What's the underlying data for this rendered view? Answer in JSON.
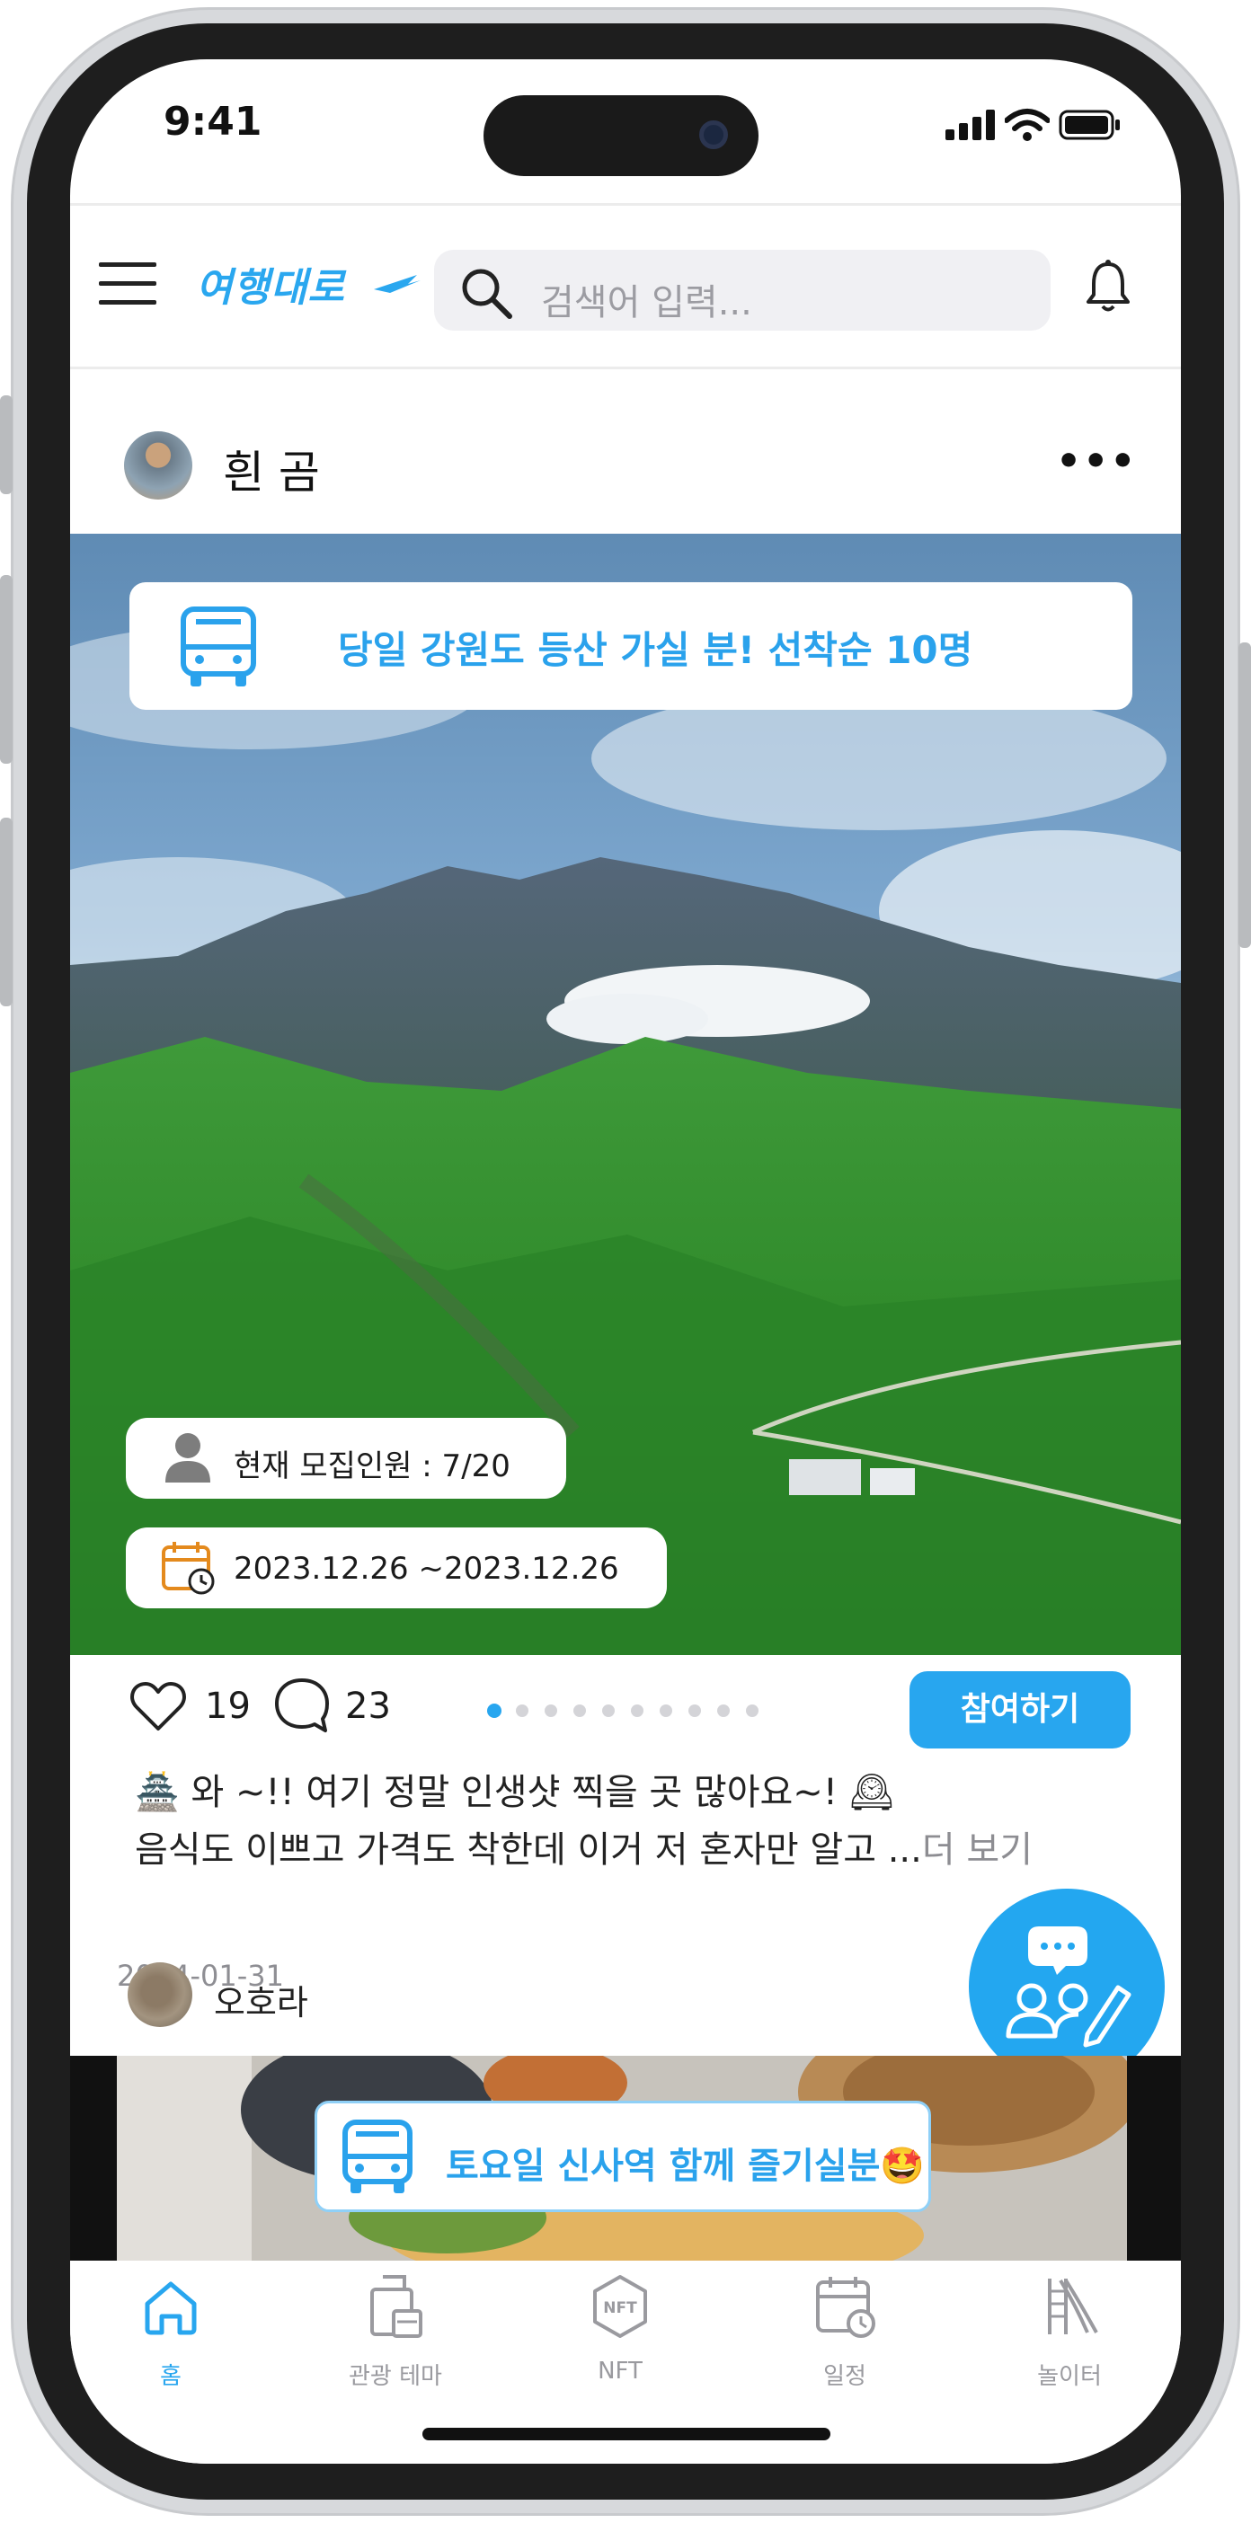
{
  "status_bar": {
    "time": "9:41"
  },
  "header": {
    "logo_text": "여행대로",
    "search_placeholder": "검색어 입력...",
    "icons": [
      "menu-icon",
      "search-icon",
      "bell-icon"
    ]
  },
  "post1": {
    "username": "흰 곰",
    "banner_text": "당일 강원도 등산 가실 분! 선착순 10명",
    "members_text": "현재 모집인원 : 7/20",
    "period_text": "2023.12.26 ~2023.12.26",
    "likes": "19",
    "comments": "23",
    "carousel_count": 10,
    "carousel_active": 0,
    "join_label": "참여하기",
    "caption_line1": "🏯 와 ~!! 여기 정말 인생샷 찍을 곳 많아요~! 🕰",
    "caption_line2": "음식도 이쁘고 가격도 착한데 이거 저 혼자만 알고 ...",
    "more_label": "더 보기",
    "date": "2024-01-31"
  },
  "post2": {
    "username": "오호라",
    "banner_text": "토요일 신사역 함께 즐기실분🤩"
  },
  "tabs": [
    {
      "label": "홈",
      "icon": "home-icon",
      "active": true
    },
    {
      "label": "관광 테마",
      "icon": "luggage-icon",
      "active": false
    },
    {
      "label": "NFT",
      "icon": "nft-icon",
      "active": false
    },
    {
      "label": "일정",
      "icon": "calendar-icon",
      "active": false
    },
    {
      "label": "놀이터",
      "icon": "slide-icon",
      "active": false
    }
  ],
  "colors": {
    "accent": "#28a6ef",
    "frame": "#1e1e1e"
  }
}
